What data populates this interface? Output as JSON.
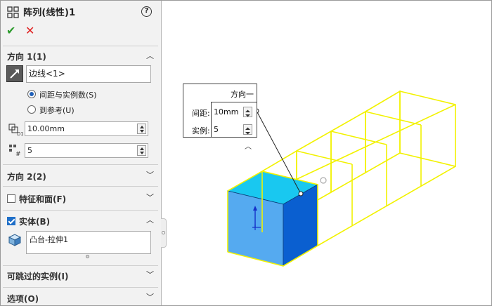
{
  "panel": {
    "title": "阵列(线性)1",
    "help_icon": "?",
    "ok_icon": "✔",
    "cancel_icon": "✕",
    "direction1": {
      "header": "方向 1(1)",
      "edge_value": "边线<1>",
      "radio_spacing": "间距与实例数(S)",
      "radio_reference": "到参考(U)",
      "selected_radio": "spacing",
      "spacing_value": "10.00mm",
      "instances_value": "5"
    },
    "direction2": {
      "header": "方向 2(2)"
    },
    "features_faces": {
      "header": "特征和面(F)",
      "checked": false
    },
    "bodies": {
      "header": "实体(B)",
      "checked": true,
      "item": "凸台-拉伸1"
    },
    "skip_instances": {
      "header": "可跳过的实例(I)"
    },
    "options": {
      "header": "选项(O)"
    }
  },
  "callout": {
    "header": "方向一",
    "spacing_label": "间距:",
    "spacing_value": "10mm",
    "instances_label": "实例:",
    "instances_value": "5"
  },
  "colors": {
    "preview_wire": "#f2f200",
    "box_top": "#19c8f0",
    "box_front": "#55aaf0",
    "box_side": "#0a5fd0"
  }
}
